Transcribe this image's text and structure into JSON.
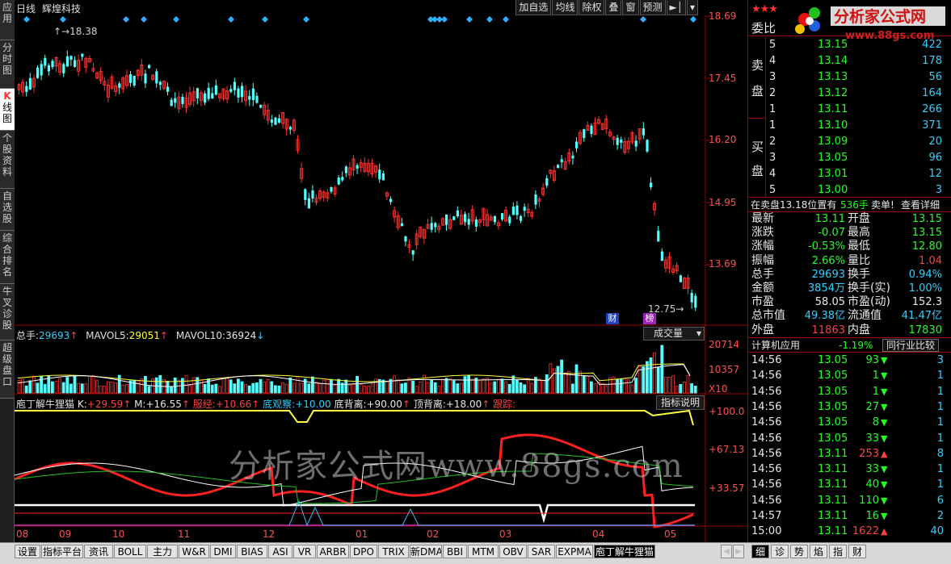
{
  "app": {
    "chart_mode": "日线",
    "stock_name": "辉煌科技"
  },
  "left_tabs": [
    {
      "label": "应用"
    },
    {
      "label": "分时图"
    },
    {
      "label": "线图",
      "prefix": "K"
    },
    {
      "label": "个股资料"
    },
    {
      "label": "自选股"
    },
    {
      "label": "综合排名"
    },
    {
      "label": "牛叉诊股"
    },
    {
      "label": "超级盘口"
    }
  ],
  "toolbar": [
    "加自选",
    "均线",
    "除权",
    "叠",
    "窗",
    "预测"
  ],
  "price_axis": [
    "18.69",
    "17.45",
    "16.20",
    "14.95",
    "13.69"
  ],
  "price_annotations": {
    "high": "18.38",
    "low": "12.75"
  },
  "event_markers": [
    "财",
    "榜"
  ],
  "volume": {
    "prefix": "总手:",
    "total": "29693",
    "ma5_label": "MAVOL5:",
    "ma5": "29051",
    "ma10_label": "MAVOL10:",
    "ma10": "36924",
    "selector": "成交量",
    "axis": [
      "20714",
      "10357"
    ],
    "multiplier": "X10"
  },
  "indicator": {
    "name": "庖丁解牛狸猫",
    "k_label": "K:",
    "k": "+29.59",
    "m_label": "M:",
    "m": "+16.55",
    "s1_label": "服经:",
    "s1": "+10.66",
    "s2_label": "底观察:",
    "s2": "+10.00",
    "s3_label": "底背离:",
    "s3": "+90.00",
    "s4_label": "顶背离:",
    "s4": "+18.00",
    "s5_label": "跟踪:",
    "help": "指标说明",
    "axis": [
      "+100.0",
      "+67.13",
      "+33.57"
    ]
  },
  "x_axis_months": [
    "08",
    "09",
    "10",
    "11",
    "12",
    "01",
    "02",
    "03",
    "04",
    "05"
  ],
  "watermark": "分析家公式网www.88gs.com",
  "logo": {
    "text": "分析家公式网",
    "url": "www.88gs.com"
  },
  "order_book": {
    "header": "委比",
    "sell_label": [
      "卖",
      "盘"
    ],
    "buy_label": [
      "买",
      "盘"
    ],
    "sell": [
      {
        "lvl": "5",
        "price": "13.15",
        "vol": "422"
      },
      {
        "lvl": "4",
        "price": "13.14",
        "vol": "178"
      },
      {
        "lvl": "3",
        "price": "13.13",
        "vol": "56"
      },
      {
        "lvl": "2",
        "price": "13.12",
        "vol": "164"
      },
      {
        "lvl": "1",
        "price": "13.11",
        "vol": "266"
      }
    ],
    "buy": [
      {
        "lvl": "1",
        "price": "13.10",
        "vol": "371"
      },
      {
        "lvl": "2",
        "price": "13.09",
        "vol": "20"
      },
      {
        "lvl": "3",
        "price": "13.05",
        "vol": "96"
      },
      {
        "lvl": "4",
        "price": "13.01",
        "vol": "12"
      },
      {
        "lvl": "5",
        "price": "13.00",
        "vol": "3"
      }
    ]
  },
  "notice": {
    "text": "在卖盘13.18位置有",
    "qty": "536手",
    "action": "卖单!",
    "link": "查看详细"
  },
  "quote": [
    {
      "l1": "最新",
      "v1": "13.11",
      "c1": "green",
      "l2": "开盘",
      "v2": "13.15",
      "c2": "green"
    },
    {
      "l1": "涨跌",
      "v1": "-0.07",
      "c1": "green",
      "l2": "最高",
      "v2": "13.15",
      "c2": "green"
    },
    {
      "l1": "涨幅",
      "v1": "-0.53%",
      "c1": "green",
      "l2": "最低",
      "v2": "12.80",
      "c2": "green"
    },
    {
      "l1": "振幅",
      "v1": "2.66%",
      "c1": "green",
      "l2": "量比",
      "v2": "1.04",
      "c2": "red"
    },
    {
      "l1": "总手",
      "v1": "29693",
      "c1": "cyan",
      "l2": "换手",
      "v2": "0.94%",
      "c2": "cyan"
    },
    {
      "l1": "金额",
      "v1": "3854万",
      "c1": "cyan",
      "l2": "换手(实)",
      "v2": "1.00%",
      "c2": "cyan"
    },
    {
      "l1": "市盈",
      "v1": "58.05",
      "c1": "white",
      "l2": "市盈(动)",
      "v2": "152.3",
      "c2": "white"
    },
    {
      "l1": "总市值",
      "v1": "49.38亿",
      "c1": "cyan",
      "l2": "流通值",
      "v2": "41.47亿",
      "c2": "cyan"
    },
    {
      "l1": "外盘",
      "v1": "11863",
      "c1": "red",
      "l2": "内盘",
      "v2": "17830",
      "c2": "green"
    }
  ],
  "sector": {
    "name": "计算机应用",
    "change": "-1.19%",
    "compare": "同行业比较"
  },
  "ticks": [
    {
      "t": "14:56",
      "p": "13.05",
      "v": "93",
      "dir": "down",
      "n": "3"
    },
    {
      "t": "14:56",
      "p": "13.05",
      "v": "1",
      "dir": "down",
      "n": "1"
    },
    {
      "t": "14:56",
      "p": "13.05",
      "v": "1",
      "dir": "down",
      "n": "1"
    },
    {
      "t": "14:56",
      "p": "13.05",
      "v": "27",
      "dir": "down",
      "n": "1"
    },
    {
      "t": "14:56",
      "p": "13.05",
      "v": "8",
      "dir": "down",
      "n": "1"
    },
    {
      "t": "14:56",
      "p": "13.05",
      "v": "33",
      "dir": "down",
      "n": "1"
    },
    {
      "t": "14:56",
      "p": "13.11",
      "v": "253",
      "dir": "up",
      "n": "8"
    },
    {
      "t": "14:56",
      "p": "13.11",
      "v": "33",
      "dir": "down",
      "n": "1"
    },
    {
      "t": "14:56",
      "p": "13.11",
      "v": "40",
      "dir": "down",
      "n": "1"
    },
    {
      "t": "14:56",
      "p": "13.11",
      "v": "110",
      "dir": "down",
      "n": "6"
    },
    {
      "t": "14:57",
      "p": "13.11",
      "v": "16",
      "dir": "down",
      "n": "2"
    },
    {
      "t": "15:00",
      "p": "13.11",
      "v": "1622",
      "dir": "up",
      "n": "40"
    }
  ],
  "bottom_tabs": [
    "设置",
    "指标平台",
    "资讯",
    "BOLL",
    "主力",
    "W&R",
    "DMI",
    "BIAS",
    "ASI",
    "VR",
    "ARBR",
    "DPO",
    "TRIX",
    "新DMA",
    "BBI",
    "MTM",
    "OBV",
    "SAR",
    "EXPMA",
    "庖丁解牛狸猫"
  ],
  "right_bottom_tabs": [
    "细",
    "诊",
    "势",
    "焰",
    "指",
    "财"
  ],
  "colors": {
    "up": "#ff3030",
    "down": "#54ffff",
    "grid": "#990000",
    "axis_text": "#ff5050",
    "bg": "#000000"
  }
}
